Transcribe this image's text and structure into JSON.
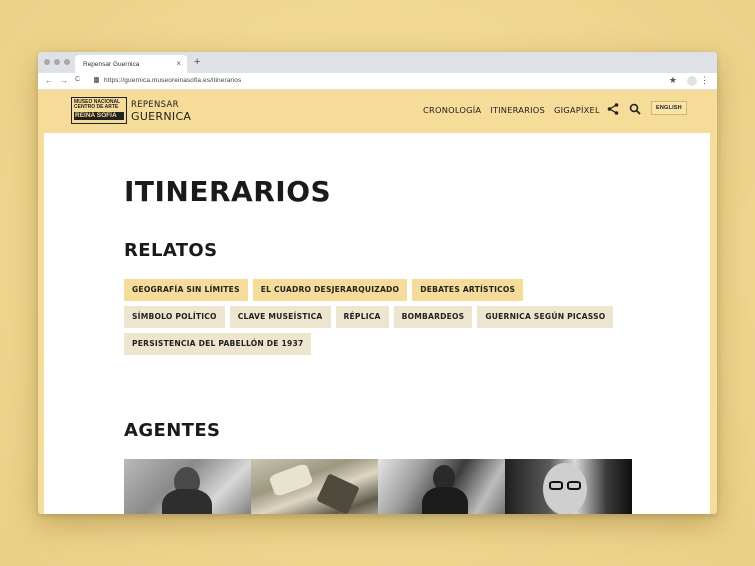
{
  "browser": {
    "tab_title": "Repensar Guernica",
    "tab_close": "×",
    "new_tab": "+",
    "url": "https://guernica.museoreinasofia.es/itinerarios",
    "back": "←",
    "forward": "→",
    "reload": "C",
    "star": "★",
    "menu": "⋮"
  },
  "header": {
    "logo_lines": [
      "MUSEO NACIONAL",
      "CENTRO DE ARTE",
      "REINA SOFIA"
    ],
    "site_name_top": "REPENSAR",
    "site_name_bottom": "GUERNICA",
    "nav": [
      "CRONOLOGÍA",
      "ITINERARIOS",
      "GIGAPÍXEL"
    ],
    "language": "ENGLISH"
  },
  "main": {
    "title": "ITINERARIOS",
    "relatos_heading": "RELATOS",
    "tags": [
      [
        "GEOGRAFÍA SIN LÍMITES",
        "EL CUADRO DESJERARQUIZADO",
        "DEBATES ARTÍSTICOS"
      ],
      [
        "SÍMBOLO POLÍTICO",
        "CLAVE MUSEÍSTICA",
        "RÉPLICA",
        "BOMBARDEOS",
        "GUERNICA SEGÚN PICASSO"
      ],
      [
        "PERSISTENCIA DEL PABELLÓN DE 1937"
      ]
    ],
    "agents_heading": "AGENTES"
  }
}
